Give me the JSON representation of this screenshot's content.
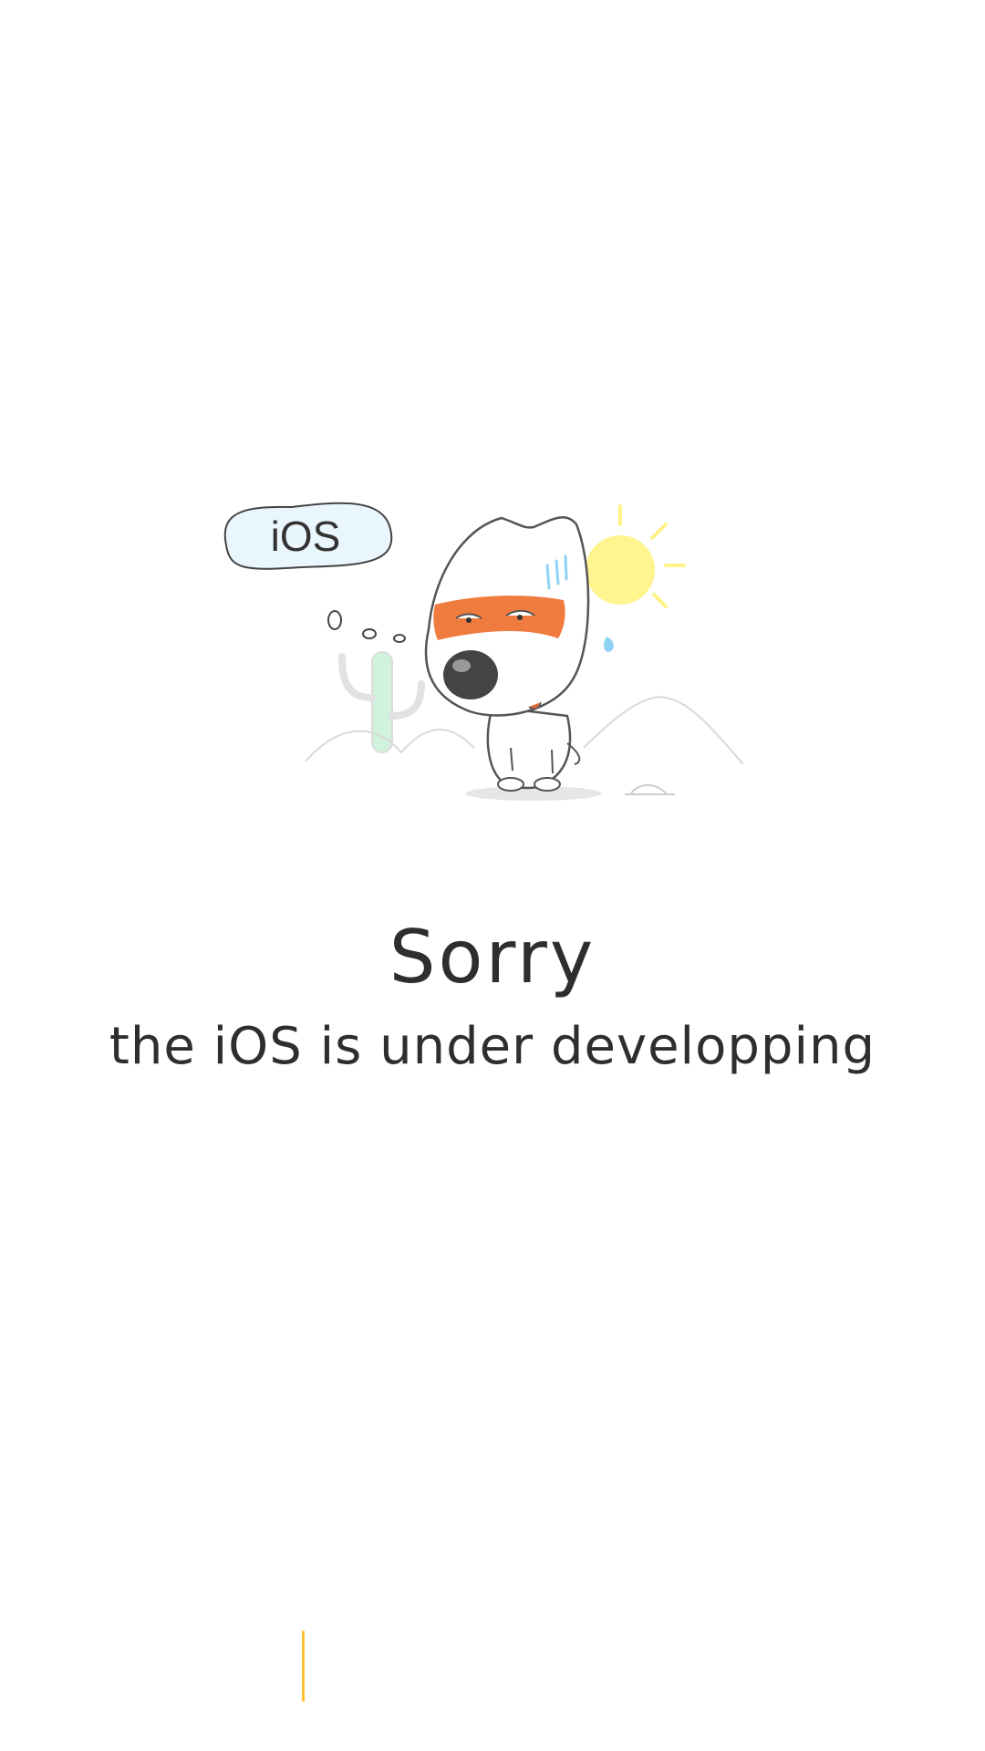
{
  "illustration": {
    "bubble_text": "iOS",
    "icon": "mascot-dog-thinking-icon"
  },
  "message": {
    "title": "Sorry",
    "subtitle": "the iOS is under developping"
  },
  "colors": {
    "text": "#2e2e2e",
    "accent": "#ffc233",
    "mask": "#f07b3f",
    "bubble_fill": "#eaf6fd",
    "sun": "#fff27a"
  }
}
